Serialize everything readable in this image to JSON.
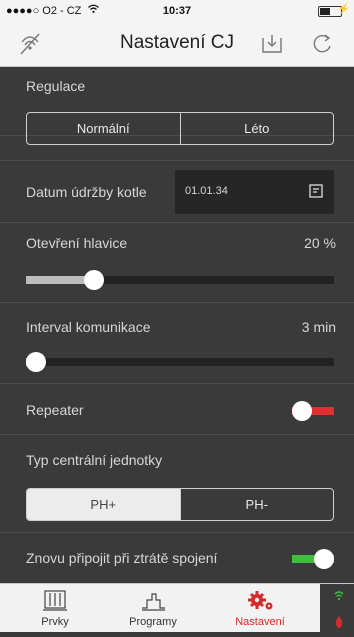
{
  "status": {
    "carrier": "●●●●○ O2 - CZ",
    "wifi_icon": "wifi-icon",
    "time": "10:37"
  },
  "navbar": {
    "title": "Nastavení CJ"
  },
  "regulace": {
    "label": "Regulace",
    "options": [
      "Normální",
      "Léto"
    ],
    "selected": "Normální"
  },
  "maintenance": {
    "label": "Datum údržby kotle",
    "value": "01.01.34"
  },
  "valve": {
    "label": "Otevření hlavice",
    "value_text": "20 %",
    "value": 0.2
  },
  "comm": {
    "label": "Interval komunikace",
    "value_text": "3 min",
    "value": 0.0
  },
  "repeater": {
    "label": "Repeater",
    "on": false,
    "color": "#e03030"
  },
  "unit_type": {
    "label": "Typ centrální jednotky",
    "options": [
      "PH+",
      "PH-"
    ],
    "selected": "PH+"
  },
  "reconnect": {
    "label": "Znovu připojit při ztrátě spojení",
    "on": true,
    "color": "#3fbe3f"
  },
  "tabs": [
    {
      "label": "Prvky",
      "icon": "radiator-icon"
    },
    {
      "label": "Programy",
      "icon": "schedule-icon"
    },
    {
      "label": "Nastavení",
      "icon": "gears-icon",
      "active": true
    }
  ],
  "colors": {
    "accent": "#d52a2a",
    "background": "#3a3a3a"
  }
}
